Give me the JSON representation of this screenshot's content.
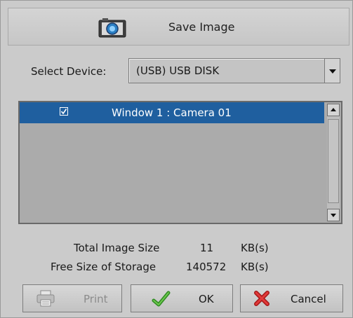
{
  "dialog": {
    "title": "Save Image",
    "icons": {
      "title": "camera-icon",
      "print": "printer-icon",
      "ok": "green-check-icon",
      "cancel": "red-x-icon"
    }
  },
  "device": {
    "label": "Select Device:",
    "value": "(USB)  USB DISK"
  },
  "list": {
    "items": [
      {
        "checked": true,
        "label": "Window 1 : Camera 01"
      }
    ]
  },
  "info": {
    "total_label": "Total Image Size",
    "total_value": "11",
    "total_unit": "KB(s)",
    "free_label": "Free Size of Storage",
    "free_value": "140572",
    "free_unit": "KB(s)"
  },
  "buttons": {
    "print": "Print",
    "ok": "OK",
    "cancel": "Cancel"
  },
  "colors": {
    "selection": "#1f5f9f",
    "ok_icon": "#3a9a2a",
    "cancel_icon": "#cc2222"
  }
}
